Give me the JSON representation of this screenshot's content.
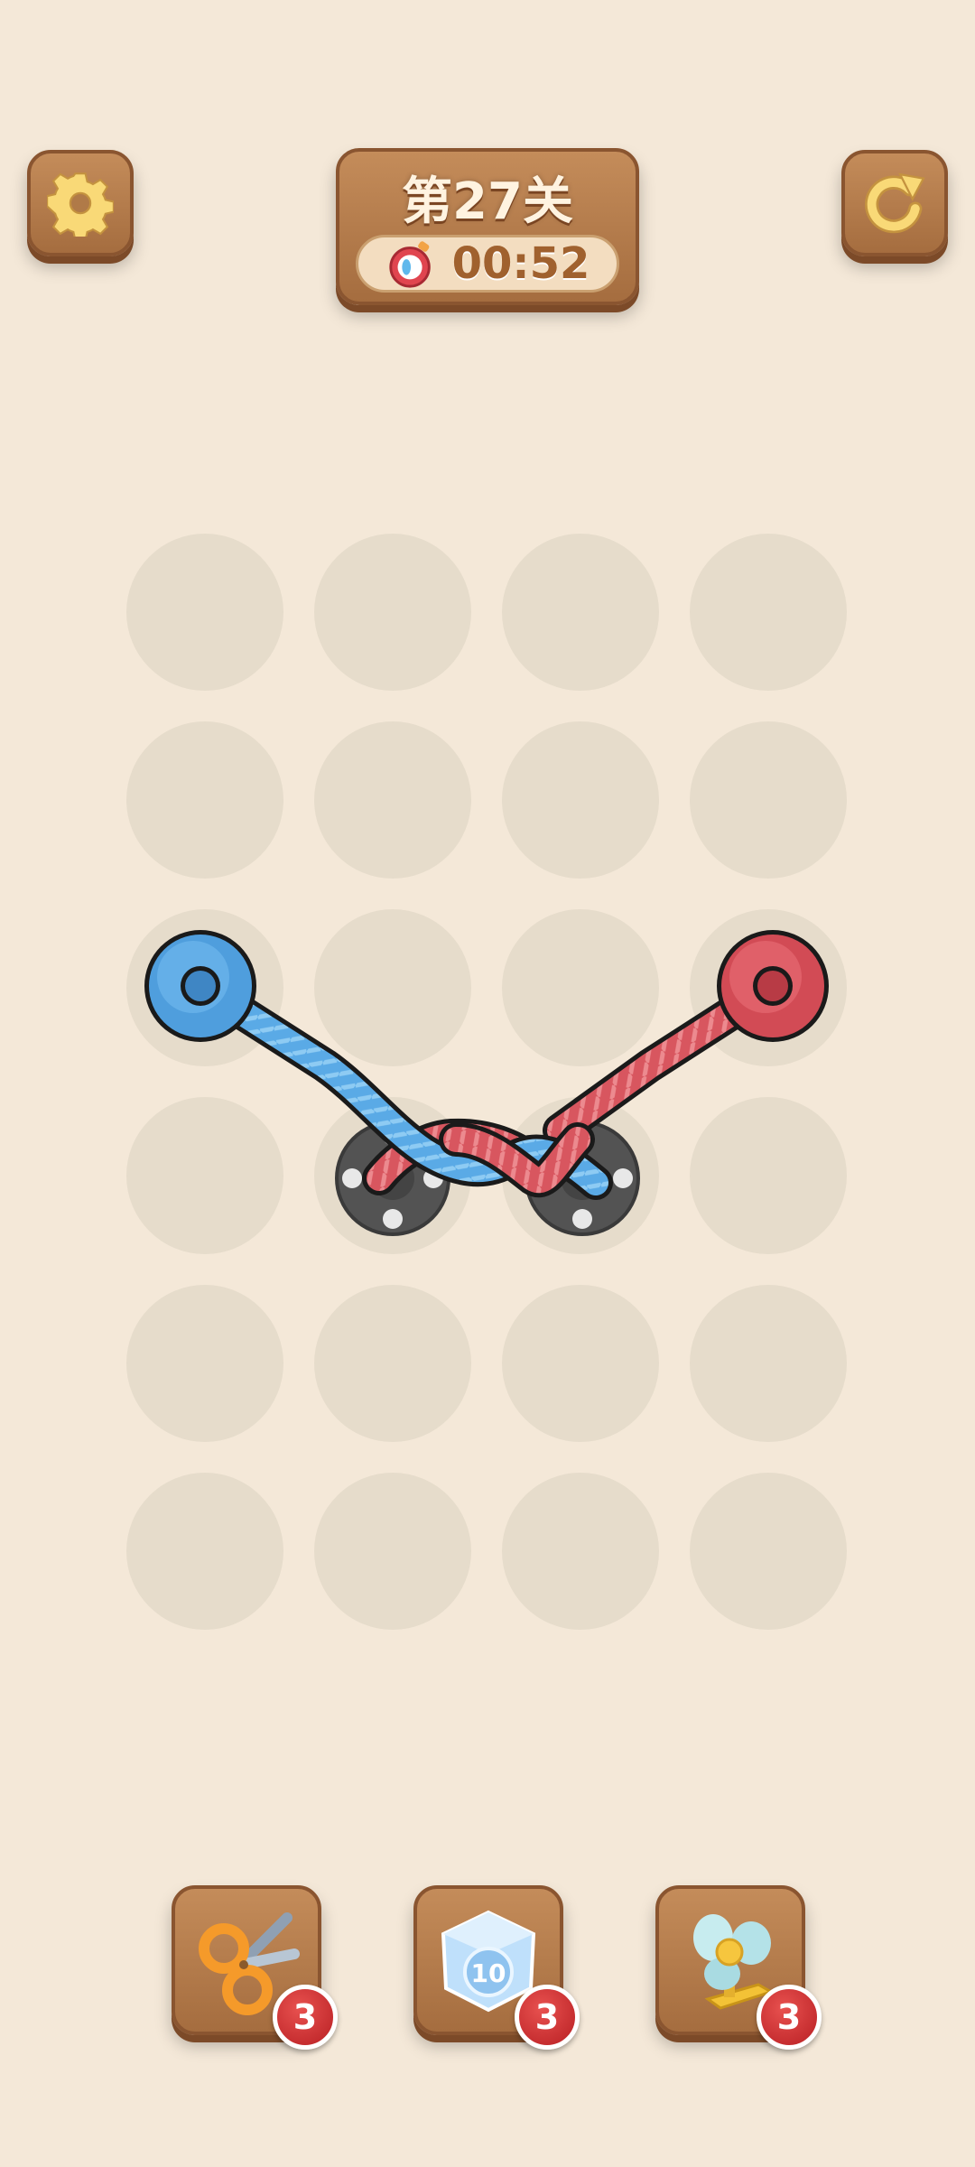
{
  "header": {
    "level_label": "第27关",
    "timer": "00:52",
    "settings_icon": "gear-icon",
    "restart_icon": "restart-icon",
    "timer_icon": "stopwatch-icon"
  },
  "colors": {
    "background": "#f4e8d8",
    "wood": "#b07a48",
    "empty_hole": "#e6dccb",
    "rope_blue": "#5aaae6",
    "rope_red": "#d8565f"
  },
  "board": {
    "rows": 6,
    "cols": 4,
    "ropes": [
      {
        "color": "blue",
        "from": "row3-col1",
        "to": "row4-col3"
      },
      {
        "color": "red",
        "from": "row3-col4",
        "to": "row4-col2"
      }
    ]
  },
  "tools": [
    {
      "name": "scissors",
      "icon": "scissors-icon",
      "count": "3"
    },
    {
      "name": "freeze",
      "icon": "ice-cube-icon",
      "label": "10",
      "count": "3"
    },
    {
      "name": "fan",
      "icon": "fan-icon",
      "count": "3"
    }
  ]
}
